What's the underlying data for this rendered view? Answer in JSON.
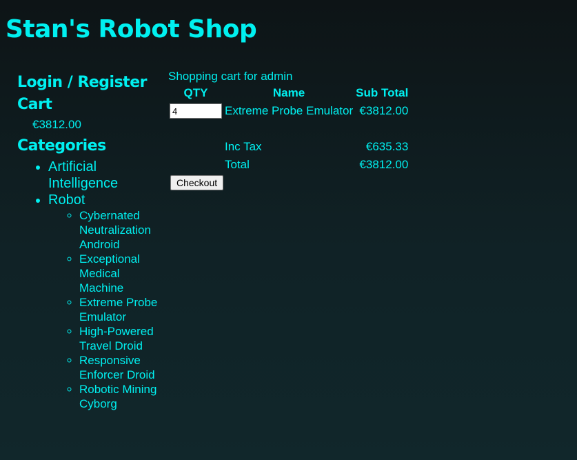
{
  "site": {
    "title": "Stan's Robot Shop"
  },
  "sidebar": {
    "login_register": "Login / Register",
    "cart_heading": "Cart",
    "cart_total": "€3812.00",
    "categories_heading": "Categories",
    "categories": [
      {
        "label": "Artificial Intelligence"
      },
      {
        "label": "Robot",
        "items": [
          "Cybernated Neutralization Android",
          "Exceptional Medical Machine",
          "Extreme Probe Emulator",
          "High-Powered Travel Droid",
          "Responsive Enforcer Droid",
          "Robotic Mining Cyborg"
        ]
      }
    ]
  },
  "cart": {
    "caption": "Shopping cart for admin",
    "headers": {
      "qty": "QTY",
      "name": "Name",
      "subtotal": "Sub Total"
    },
    "items": [
      {
        "qty": "4",
        "name": "Extreme Probe Emulator",
        "subtotal": "€3812.00"
      }
    ],
    "tax_label": "Inc Tax",
    "tax_value": "€635.33",
    "total_label": "Total",
    "total_value": "€3812.00",
    "checkout_label": "Checkout"
  },
  "colors": {
    "text": "#00f0f0",
    "background_top": "#0d1416",
    "background_bottom": "#11272b"
  }
}
